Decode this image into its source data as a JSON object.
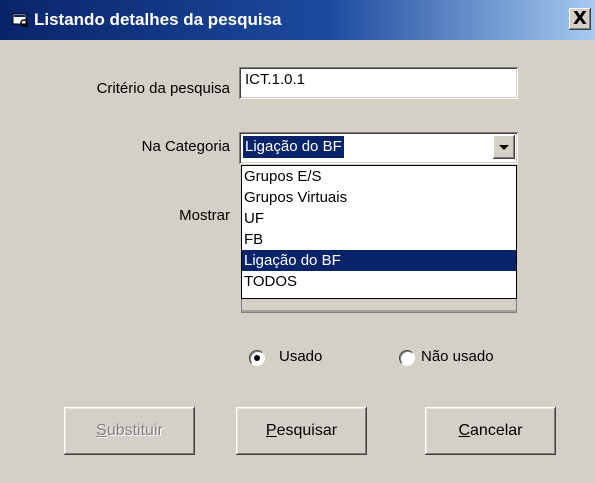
{
  "window": {
    "title": "Listando detalhes da pesquisa",
    "close_label": "X"
  },
  "form": {
    "criterio_label": "Critério da pesquisa",
    "criterio_value": "ICT.1.0.1",
    "categoria_label": "Na Categoria",
    "categoria_value": "Ligação do BF",
    "mostrar_label": "Mostrar",
    "categoria_options": [
      "Grupos E/S",
      "Grupos Virtuais",
      "UF",
      "FB",
      "Ligação do BF",
      "TODOS"
    ],
    "categoria_selected_index": 4
  },
  "radios": {
    "usado_label": "Usado",
    "usado_checked": true,
    "nao_usado_label": "Não usado",
    "nao_usado_checked": false
  },
  "buttons": {
    "substituir_mnemonic": "S",
    "substituir_rest": "ubstituir",
    "substituir_enabled": false,
    "pesquisar_mnemonic": "P",
    "pesquisar_rest": "esquisar",
    "cancelar_mnemonic": "C",
    "cancelar_rest": "ancelar"
  },
  "colors": {
    "face": "#d4d0c8",
    "title_start": "#0a246a",
    "title_end": "#a6caf0",
    "highlight": "#0a246a"
  }
}
